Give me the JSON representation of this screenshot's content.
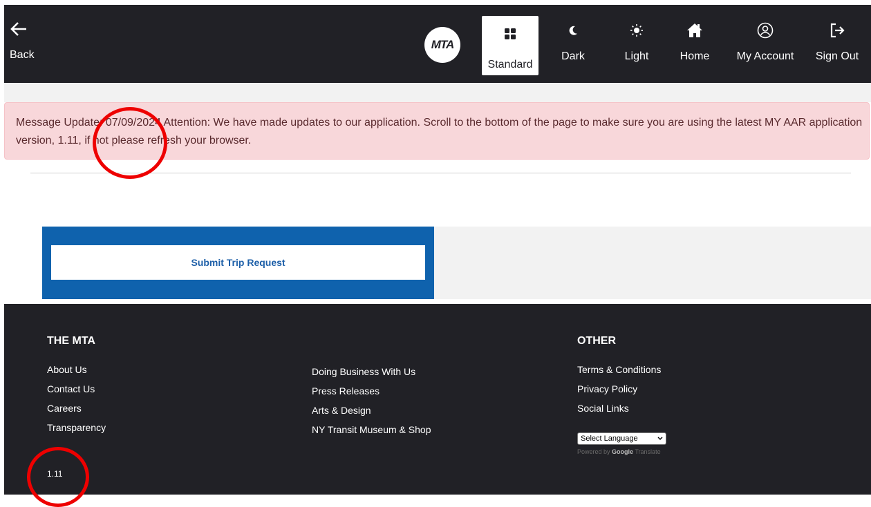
{
  "header": {
    "back_label": "Back",
    "logo_text": "MTA",
    "nav": {
      "standard": "Standard",
      "dark": "Dark",
      "light": "Light",
      "home": "Home",
      "my_account": "My Account",
      "sign_out": "Sign Out"
    }
  },
  "alert": {
    "message": "Message Update: 07/09/2024 Attention: We have made updates to our application. Scroll to the bottom of the page to make sure you are using the latest MY AAR application version, 1.11, if not please refresh your browser."
  },
  "submit": {
    "label": "Submit Trip Request"
  },
  "footer": {
    "the_mta_heading": "THE MTA",
    "col1": [
      "About Us",
      "Contact Us",
      "Careers",
      "Transparency"
    ],
    "col2": [
      "Doing Business With Us",
      "Press Releases",
      "Arts & Design",
      "NY Transit Museum & Shop"
    ],
    "other_heading": "OTHER",
    "col3": [
      "Terms & Conditions",
      "Privacy Policy",
      "Social Links"
    ],
    "language_select": "Select Language",
    "powered_by": "Powered by",
    "google": "Google",
    "translate": "Translate",
    "version": "1.11"
  },
  "colors": {
    "header_bg": "#212126",
    "alert_bg": "#f8d7da",
    "submit_blue": "#0f62ad",
    "annotation": "#ee0000"
  }
}
